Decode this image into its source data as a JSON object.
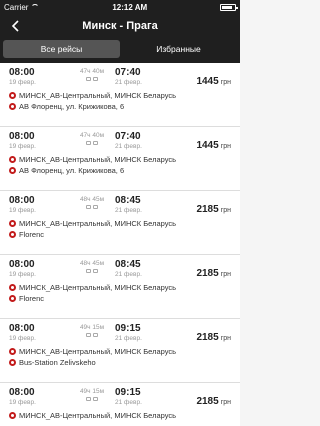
{
  "status": {
    "carrier": "Carrier",
    "time": "12:12 AM"
  },
  "header": {
    "title": "Минск - Прага",
    "back_icon": "chevron-left-icon"
  },
  "tabs": [
    {
      "label": "Все рейсы",
      "active": true
    },
    {
      "label": "Избранные",
      "active": false
    }
  ],
  "trips": [
    {
      "dep_time": "08:00",
      "dep_date": "19 февр.",
      "duration": "47ч 40м",
      "arr_time": "07:40",
      "arr_date": "21 февр.",
      "price": "1445",
      "currency": "грн",
      "from": "МИНСК_АВ-Центральный, МИНСК Беларусь",
      "to": "АВ Флоренц, ул. Крижикова, 6"
    },
    {
      "dep_time": "08:00",
      "dep_date": "19 февр.",
      "duration": "47ч 40м",
      "arr_time": "07:40",
      "arr_date": "21 февр.",
      "price": "1445",
      "currency": "грн",
      "from": "МИНСК_АВ-Центральный, МИНСК Беларусь",
      "to": "АВ Флоренц, ул. Крижикова, 6"
    },
    {
      "dep_time": "08:00",
      "dep_date": "19 февр.",
      "duration": "48ч 45м",
      "arr_time": "08:45",
      "arr_date": "21 февр.",
      "price": "2185",
      "currency": "грн",
      "from": "МИНСК_АВ-Центральный, МИНСК Беларусь",
      "to": "Florenc"
    },
    {
      "dep_time": "08:00",
      "dep_date": "19 февр.",
      "duration": "48ч 45м",
      "arr_time": "08:45",
      "arr_date": "21 февр.",
      "price": "2185",
      "currency": "грн",
      "from": "МИНСК_АВ-Центральный, МИНСК Беларусь",
      "to": "Florenc"
    },
    {
      "dep_time": "08:00",
      "dep_date": "19 февр.",
      "duration": "49ч 15м",
      "arr_time": "09:15",
      "arr_date": "21 февр.",
      "price": "2185",
      "currency": "грн",
      "from": "МИНСК_АВ-Центральный, МИНСК Беларусь",
      "to": "Bus-Station Zelivskeho"
    },
    {
      "dep_time": "08:00",
      "dep_date": "19 февр.",
      "duration": "49ч 15м",
      "arr_time": "09:15",
      "arr_date": "21 февр.",
      "price": "2185",
      "currency": "грн",
      "from": "МИНСК_АВ-Центральный, МИНСК Беларусь",
      "to": ""
    }
  ]
}
